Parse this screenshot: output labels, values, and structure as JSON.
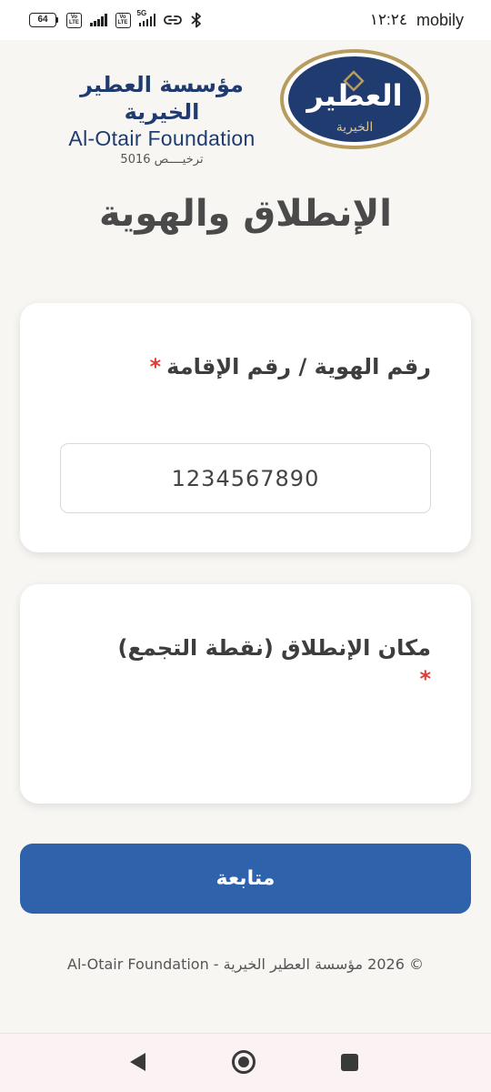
{
  "status_bar": {
    "battery": "64",
    "volte_top": "Vo",
    "volte_bottom": "LTE",
    "network_5g": "5G",
    "time": "١٢:٢٤",
    "carrier": "mobily"
  },
  "header": {
    "emblem_name": "العطير",
    "emblem_sub": "الخيرية",
    "brand_ar": "مؤسسة العطير الخيرية",
    "brand_en": "Al-Otair Foundation",
    "license": "ترخيــــص 5016"
  },
  "page": {
    "title": "الإنطلاق والهوية"
  },
  "id_card": {
    "label": "رقم الهوية / رقم الإقامة",
    "required_mark": "*",
    "value": "1234567890"
  },
  "location_card": {
    "label": "مكان الإنطلاق (نقطة التجمع)",
    "required_mark": "*"
  },
  "actions": {
    "continue_label": "متابعة"
  },
  "footer": {
    "copyright": "© 2026 مؤسسة العطير الخيرية - Al-Otair Foundation"
  },
  "colors": {
    "brand_navy": "#1f3b70",
    "gold": "#b89c5e",
    "button_blue": "#2e63ac",
    "required_red": "#e53935",
    "page_bg": "#f7f6f2"
  }
}
